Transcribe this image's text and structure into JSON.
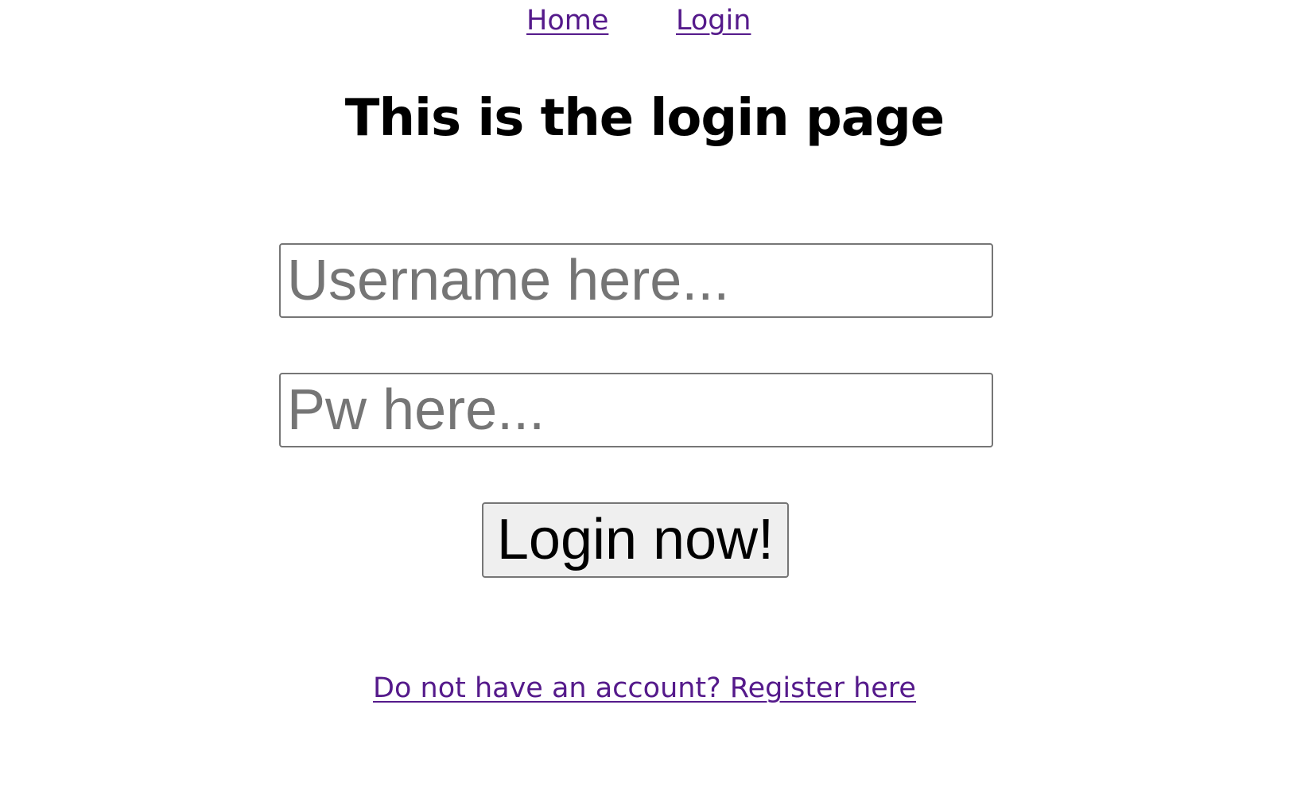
{
  "nav": {
    "items": [
      {
        "label": "Home"
      },
      {
        "label": "Login"
      }
    ]
  },
  "main": {
    "title": "This is the login page"
  },
  "form": {
    "username": {
      "value": "",
      "placeholder": "Username here..."
    },
    "password": {
      "value": "",
      "placeholder": "Pw here..."
    },
    "submit_label": "Login now!"
  },
  "footer": {
    "register_link": "Do not have an account? Register here"
  },
  "colors": {
    "link": "#551a8b",
    "text": "#000000",
    "placeholder": "#757575",
    "input_border": "#767676",
    "button_background": "#efefef",
    "page_background": "#ffffff"
  }
}
